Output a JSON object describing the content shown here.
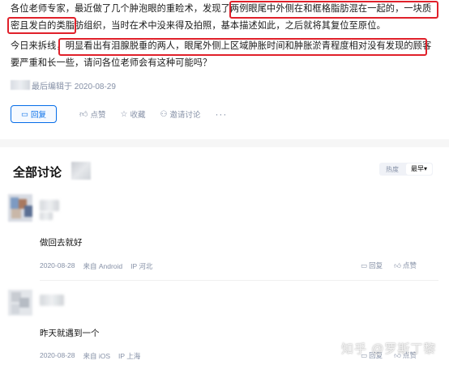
{
  "post": {
    "paragraph1": "各位老师专家，最近做了几个肿泡眼的重睑术，发现了两例眼尾中外侧在和框格脂肪混在一起的，一块质密且发白的类脂肪组织，当时在术中没来得及拍照，基本描述如此，之后就将其复位至原位。",
    "paragraph2": "今日来拆线，明显看出有泪腺脱垂的两人，眼尾外侧上区域肿胀时间和肿胀淤青程度相对没有发现的顾客要严重和长一些，请问各位老师会有这种可能吗？",
    "edit_time": "最后编辑于 2020-08-29"
  },
  "actions": {
    "reply": "回复",
    "like": "点赞",
    "collect": "收藏",
    "invite": "邀请讨论",
    "more": "···"
  },
  "discussion": {
    "title": "全部讨论",
    "sort_hot": "热度",
    "sort_new": "最早▾"
  },
  "comments": [
    {
      "body": "做回去就好",
      "date": "2020-08-28",
      "source": "来自 Android",
      "ip": "IP 河北",
      "reply": "回复",
      "like": "点赞"
    },
    {
      "body": "昨天就遇到一个",
      "date": "2020-08-28",
      "source": "来自 iOS",
      "ip": "IP 上海",
      "reply": "回复",
      "like": "点赞"
    }
  ],
  "watermark": "知乎 @罗斯丁黎",
  "colors": {
    "highlight": "#e0202a",
    "accent": "#056de8",
    "meta": "#8590a6"
  }
}
